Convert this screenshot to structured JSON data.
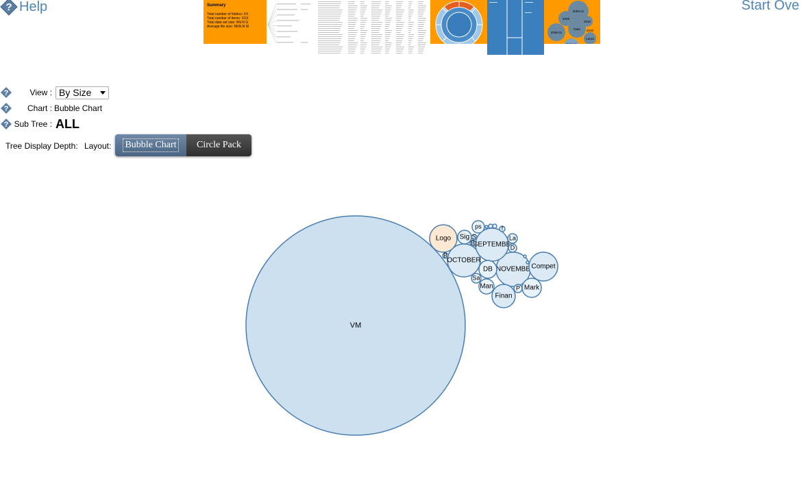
{
  "header": {
    "help_label": "Help",
    "start_over_label": "Start Ove"
  },
  "thumbnails": {
    "summary": {
      "title": "Summary",
      "lines": [
        "Total number of folders: XX",
        "Total number of items: XXX",
        "Total data set size: NN.N G",
        "Average file size: NNN.N M"
      ]
    },
    "bubble_labels": [
      "2009-01",
      "2009",
      "2010",
      "Data",
      "2008-01",
      "2010",
      "Laura",
      "2010-01"
    ]
  },
  "controls": {
    "view": {
      "label": "View :",
      "value": "By Size"
    },
    "chart": {
      "label": "Chart :",
      "value": "Bubble Chart"
    },
    "sub_tree": {
      "label": "Sub Tree :",
      "value": "ALL"
    },
    "tree_display_depth_label": "Tree Display Depth:",
    "layout_label": "Layout:",
    "layout_options": [
      "Bubble Chart",
      "Circle Pack"
    ],
    "layout_selected": "Bubble Chart"
  },
  "colors": {
    "link": "#4f86b6",
    "bubble_fill": "#cce0f0",
    "bubble_light": "#e8f2fa",
    "bubble_stroke": "#4a7eb0",
    "highlight_fill": "#fde8d4",
    "thumb_orange": "#ff9900"
  },
  "chart_data": {
    "type": "bubble",
    "nodes": [
      {
        "label": "VM",
        "size": 100,
        "highlight": false
      },
      {
        "label": "OCTOBER",
        "size": 6.5,
        "highlight": false
      },
      {
        "label": "NOVEMBE",
        "size": 6.9,
        "highlight": false
      },
      {
        "label": "SEPTEMBE",
        "size": 6.3,
        "highlight": false
      },
      {
        "label": "Compet",
        "size": 4.2,
        "highlight": false
      },
      {
        "label": "Logo",
        "size": 4.2,
        "highlight": true
      },
      {
        "label": "Finan",
        "size": 3.3,
        "highlight": false
      },
      {
        "label": "Mark",
        "size": 2.3,
        "highlight": false
      },
      {
        "label": "DB",
        "size": 1.9,
        "highlight": false
      },
      {
        "label": "Man",
        "size": 1.2,
        "highlight": false
      },
      {
        "label": "Sig",
        "size": 1.1,
        "highlight": false
      },
      {
        "label": "ps",
        "size": 0.8,
        "highlight": false
      },
      {
        "label": "Sa",
        "size": 0.5,
        "highlight": false
      },
      {
        "label": "La",
        "size": 0.5,
        "highlight": false
      },
      {
        "label": "D",
        "size": 0.3,
        "highlight": false
      },
      {
        "label": "P",
        "size": 0.3,
        "highlight": false
      },
      {
        "label": "S",
        "size": 0.2,
        "highlight": false
      },
      {
        "label": "B",
        "size": 0.2,
        "highlight": false
      },
      {
        "label": "B",
        "size": 0.2,
        "highlight": false
      },
      {
        "label": "f",
        "size": 0.2,
        "highlight": false
      },
      {
        "label": "",
        "size": 0.1,
        "highlight": false
      },
      {
        "label": "",
        "size": 0.1,
        "highlight": false
      },
      {
        "label": "",
        "size": 0.1,
        "highlight": false
      },
      {
        "label": "",
        "size": 0.05,
        "highlight": false
      },
      {
        "label": "",
        "size": 0.05,
        "highlight": false
      }
    ]
  }
}
